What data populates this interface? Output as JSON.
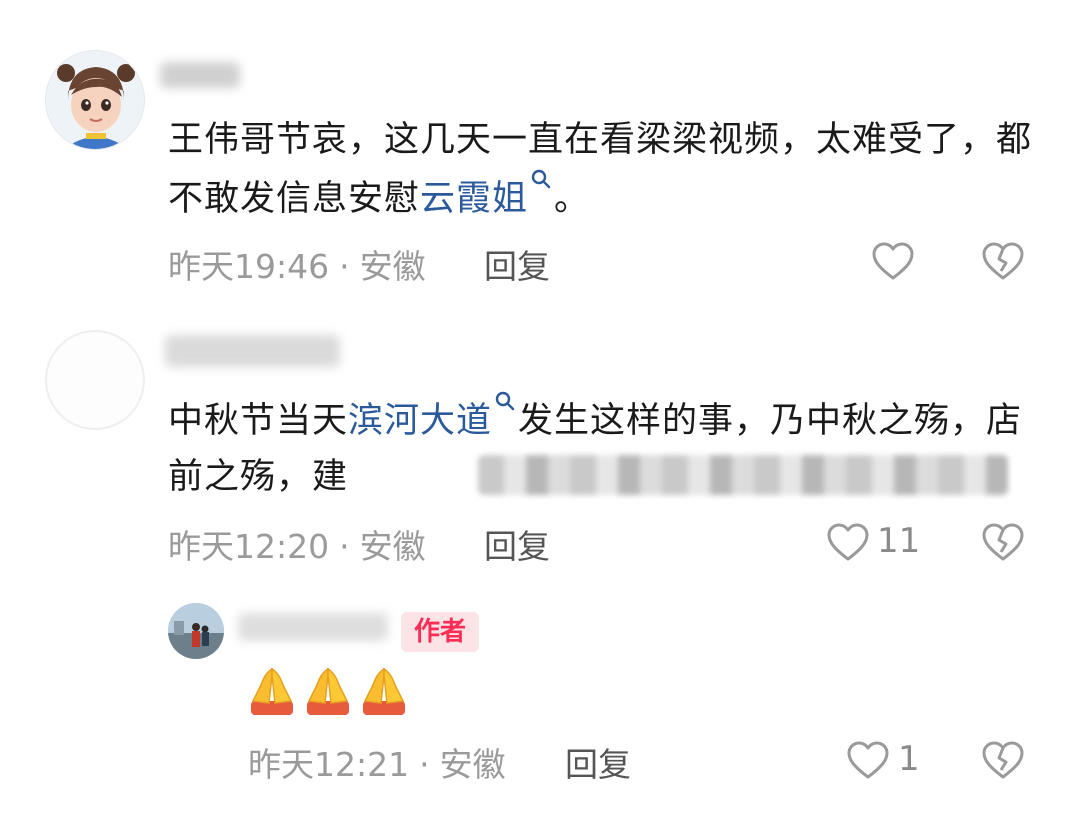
{
  "comments": [
    {
      "text_before": "王伟哥节哀，这几天一直在看梁梁视频，太难受了，都不敢发信息安慰",
      "topic": "云霞姐",
      "text_after": "。",
      "time": "昨天19:46",
      "location": "安徽",
      "reply_label": "回复"
    },
    {
      "text_before": "中秋节当天",
      "topic": "滨河大道",
      "text_after": "发生这样的事，乃中秋之殇，店前之殇，建",
      "time": "昨天12:20",
      "location": "安徽",
      "reply_label": "回复",
      "likes": "11"
    }
  ],
  "reply": {
    "badge": "作者",
    "content": "🙏🙏🙏",
    "time": "昨天12:21",
    "location": "安徽",
    "reply_label": "回复",
    "likes": "1"
  },
  "separator": "·",
  "icons": {
    "like": "heart-outline-icon",
    "dislike": "broken-heart-icon",
    "topic": "search-icon"
  },
  "colors": {
    "topic": "#2b5a9c",
    "meta": "#9a9a9a",
    "badge_text": "#ff2d55",
    "badge_bg": "#fbe3e6",
    "icon": "#9a9a9a"
  }
}
